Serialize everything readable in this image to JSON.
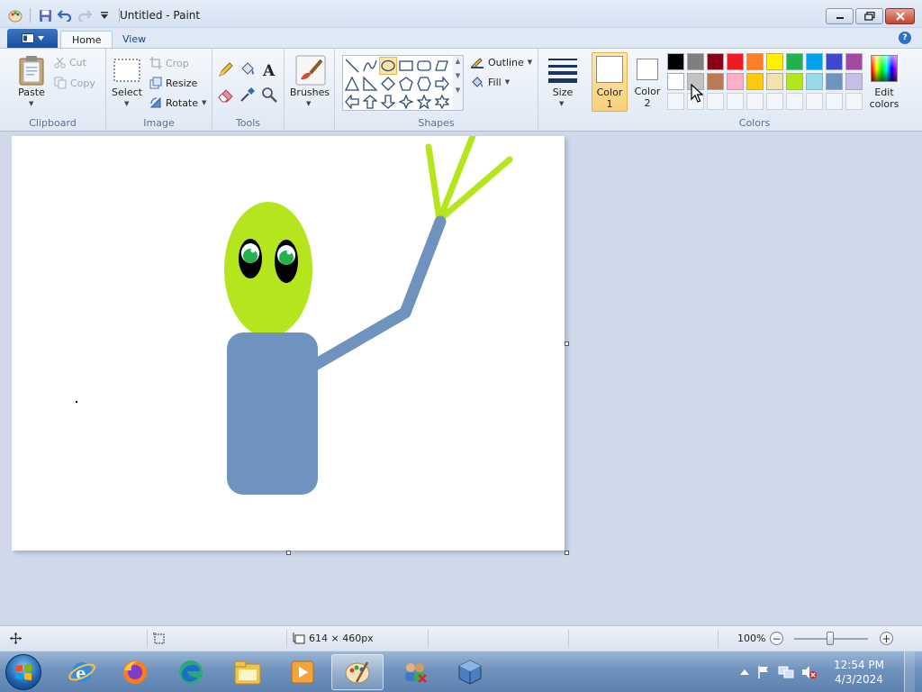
{
  "window": {
    "title": "Untitled - Paint"
  },
  "tabs": [
    {
      "label": "Home"
    },
    {
      "label": "View"
    }
  ],
  "ribbon": {
    "clipboard": {
      "label": "Clipboard",
      "paste": "Paste",
      "cut": "Cut",
      "copy": "Copy"
    },
    "image": {
      "label": "Image",
      "select": "Select",
      "crop": "Crop",
      "resize": "Resize",
      "rotate": "Rotate"
    },
    "tools": {
      "label": "Tools"
    },
    "brushes": {
      "label": "Brushes"
    },
    "shapes": {
      "label": "Shapes",
      "outline": "Outline",
      "fill": "Fill"
    },
    "size": {
      "label": "Size"
    },
    "colors": {
      "label": "Colors",
      "color1": {
        "label": "Color",
        "number": "1",
        "value": "#ffffff"
      },
      "color2": {
        "label": "Color",
        "number": "2",
        "value": "#ffffff"
      },
      "edit_label_1": "Edit",
      "edit_label_2": "colors",
      "palette_row1": [
        "#000000",
        "#7f7f7f",
        "#880015",
        "#ed1c24",
        "#ff7f27",
        "#fff200",
        "#22b14c",
        "#00a2e8",
        "#3f48cc",
        "#a349a4"
      ],
      "palette_row2": [
        "#ffffff",
        "#c3c3c3",
        "#b97a57",
        "#ffaec9",
        "#ffc90e",
        "#efe4b0",
        "#b5e61d",
        "#99d9ea",
        "#7092be",
        "#c8bfe7"
      ]
    }
  },
  "canvas": {
    "width": 614,
    "height": 460,
    "colors": {
      "head": "#b5e61d",
      "body": "#7092be",
      "eye_iris": "#22b14c",
      "eye_outer": "#000000",
      "eye_white": "#ffffff"
    }
  },
  "statusbar": {
    "dimensions": "614 × 460px",
    "zoom": "100%"
  },
  "taskbar": {
    "apps": [
      "internet-explorer-icon",
      "firefox-icon",
      "edge-icon",
      "file-explorer-icon",
      "media-player-icon",
      "paint-icon",
      "network-users-icon",
      "virtualbox-icon"
    ],
    "time": "12:54 PM",
    "date": "4/3/2024"
  }
}
